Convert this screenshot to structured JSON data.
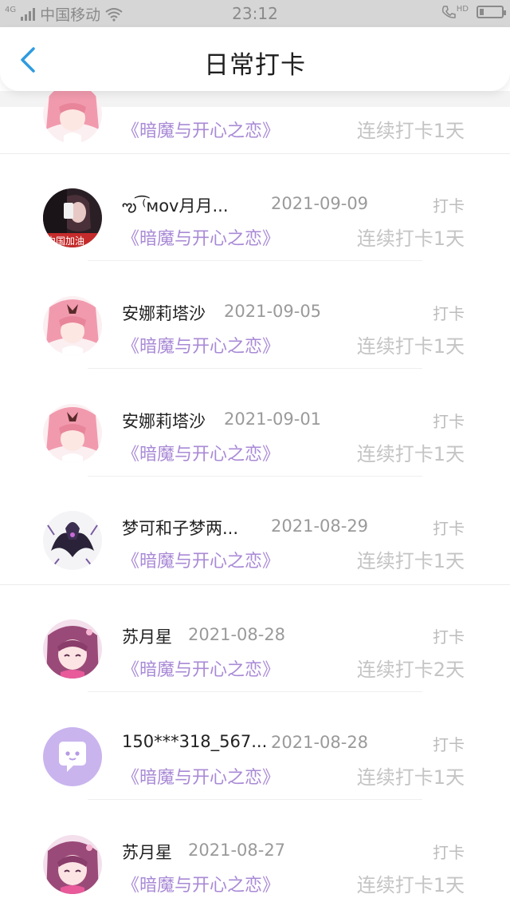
{
  "status_bar": {
    "network": "4G",
    "carrier": "中国移动",
    "time": "23:12",
    "hd_label": "HD"
  },
  "header": {
    "title": "日常打卡",
    "back_icon": "chevron-left-icon",
    "accent": "#2f9be0"
  },
  "list": {
    "book_color": "#a98ad6",
    "items": [
      {
        "name": "",
        "date": "",
        "type": "",
        "book": "《暗魔与开心之恋》",
        "streak": "连续打卡1天",
        "avatar": "anime-pink-hair"
      },
      {
        "name": "ఌ ͡⁽ᴍᴏᴠ月月...",
        "date": "2021-09-09",
        "type": "打卡",
        "book": "《暗魔与开心之恋》",
        "streak": "连续打卡1天",
        "avatar": "selfie-photo"
      },
      {
        "name": "安娜莉塔沙",
        "date": "2021-09-05",
        "type": "打卡",
        "book": "《暗魔与开心之恋》",
        "streak": "连续打卡1天",
        "avatar": "anime-pink-hair"
      },
      {
        "name": "安娜莉塔沙",
        "date": "2021-09-01",
        "type": "打卡",
        "book": "《暗魔与开心之恋》",
        "streak": "连续打卡1天",
        "avatar": "anime-pink-hair"
      },
      {
        "name": "梦可和子梦两...",
        "date": "2021-08-29",
        "type": "打卡",
        "book": "《暗魔与开心之恋》",
        "streak": "连续打卡1天",
        "avatar": "dark-creature"
      },
      {
        "name": "苏月星",
        "date": "2021-08-28",
        "type": "打卡",
        "book": "《暗魔与开心之恋》",
        "streak": "连续打卡2天",
        "avatar": "anime-purple-girl"
      },
      {
        "name": "150***318_567...",
        "date": "2021-08-28",
        "type": "打卡",
        "book": "《暗魔与开心之恋》",
        "streak": "连续打卡1天",
        "avatar": "default-chat-bubble"
      },
      {
        "name": "苏月星",
        "date": "2021-08-27",
        "type": "打卡",
        "book": "《暗魔与开心之恋》",
        "streak": "连续打卡1天",
        "avatar": "anime-purple-girl"
      }
    ]
  }
}
